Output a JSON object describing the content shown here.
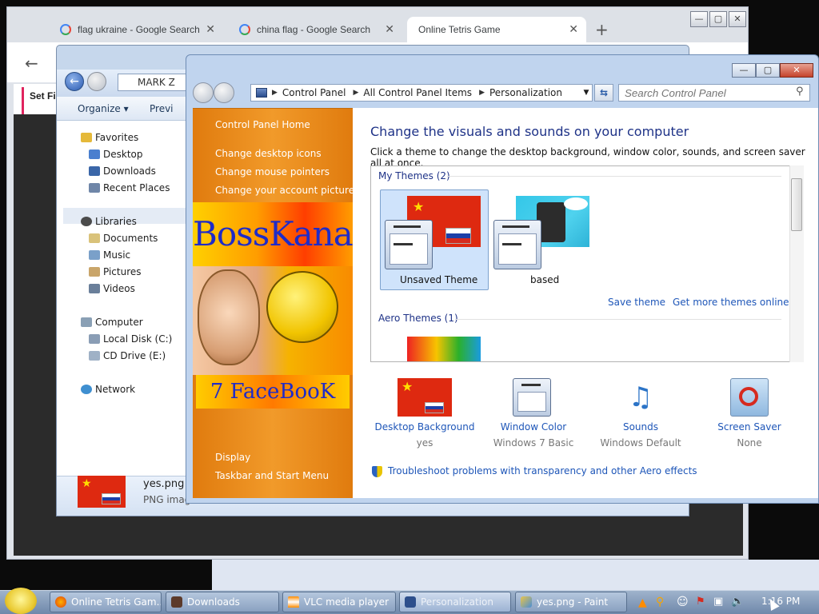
{
  "browser": {
    "tabs": [
      {
        "label": "flag ukraine - Google Search"
      },
      {
        "label": "china flag - Google Search"
      },
      {
        "label": "Online Tetris Game"
      }
    ],
    "new_tab": "+",
    "sidebar_text": "Set Fi"
  },
  "explorer": {
    "address": "MARK Z",
    "organize": "Organize ▾",
    "preview": "Previ",
    "tree": [
      {
        "label": "Favorites"
      },
      {
        "label": "Desktop"
      },
      {
        "label": "Downloads"
      },
      {
        "label": "Recent Places"
      },
      {
        "label": "Libraries"
      },
      {
        "label": "Documents"
      },
      {
        "label": "Music"
      },
      {
        "label": "Pictures"
      },
      {
        "label": "Videos"
      },
      {
        "label": "Computer"
      },
      {
        "label": "Local Disk (C:)"
      },
      {
        "label": "CD Drive (E:)"
      },
      {
        "label": "Network"
      }
    ],
    "details": {
      "name": "yes.png",
      "type": "PNG imag"
    }
  },
  "personalization": {
    "breadcrumb": [
      "Control Panel",
      "All Control Panel Items",
      "Personalization"
    ],
    "search_placeholder": "Search Control Panel",
    "sidebar": {
      "home": "Control Panel Home",
      "links": [
        "Change desktop icons",
        "Change mouse pointers",
        "Change your account picture"
      ],
      "banner1": "BossKanae",
      "banner2": "7 FaceBooK",
      "see_also_links": [
        "Display",
        "Taskbar and Start Menu"
      ]
    },
    "main": {
      "title": "Change the visuals and sounds on your computer",
      "subtitle": "Click a theme to change the desktop background, window color, sounds, and screen saver all at once.",
      "my_themes_header": "My Themes (2)",
      "themes": [
        {
          "label": "Unsaved Theme"
        },
        {
          "label": "based"
        }
      ],
      "save_theme": "Save theme",
      "get_more": "Get more themes online",
      "aero_header": "Aero Themes (1)"
    },
    "categories": [
      {
        "label": "Desktop Background",
        "value": "yes"
      },
      {
        "label": "Window Color",
        "value": "Windows 7 Basic"
      },
      {
        "label": "Sounds",
        "value": "Windows Default"
      },
      {
        "label": "Screen Saver",
        "value": "None"
      }
    ],
    "troubleshoot": "Troubleshoot problems with transparency and other Aero effects"
  },
  "taskbar": {
    "items": [
      {
        "label": "Online Tetris Gam..."
      },
      {
        "label": "Downloads"
      },
      {
        "label": "VLC media player"
      },
      {
        "label": "Personalization"
      },
      {
        "label": "yes.png - Paint"
      }
    ],
    "clock": "1:16 PM"
  }
}
